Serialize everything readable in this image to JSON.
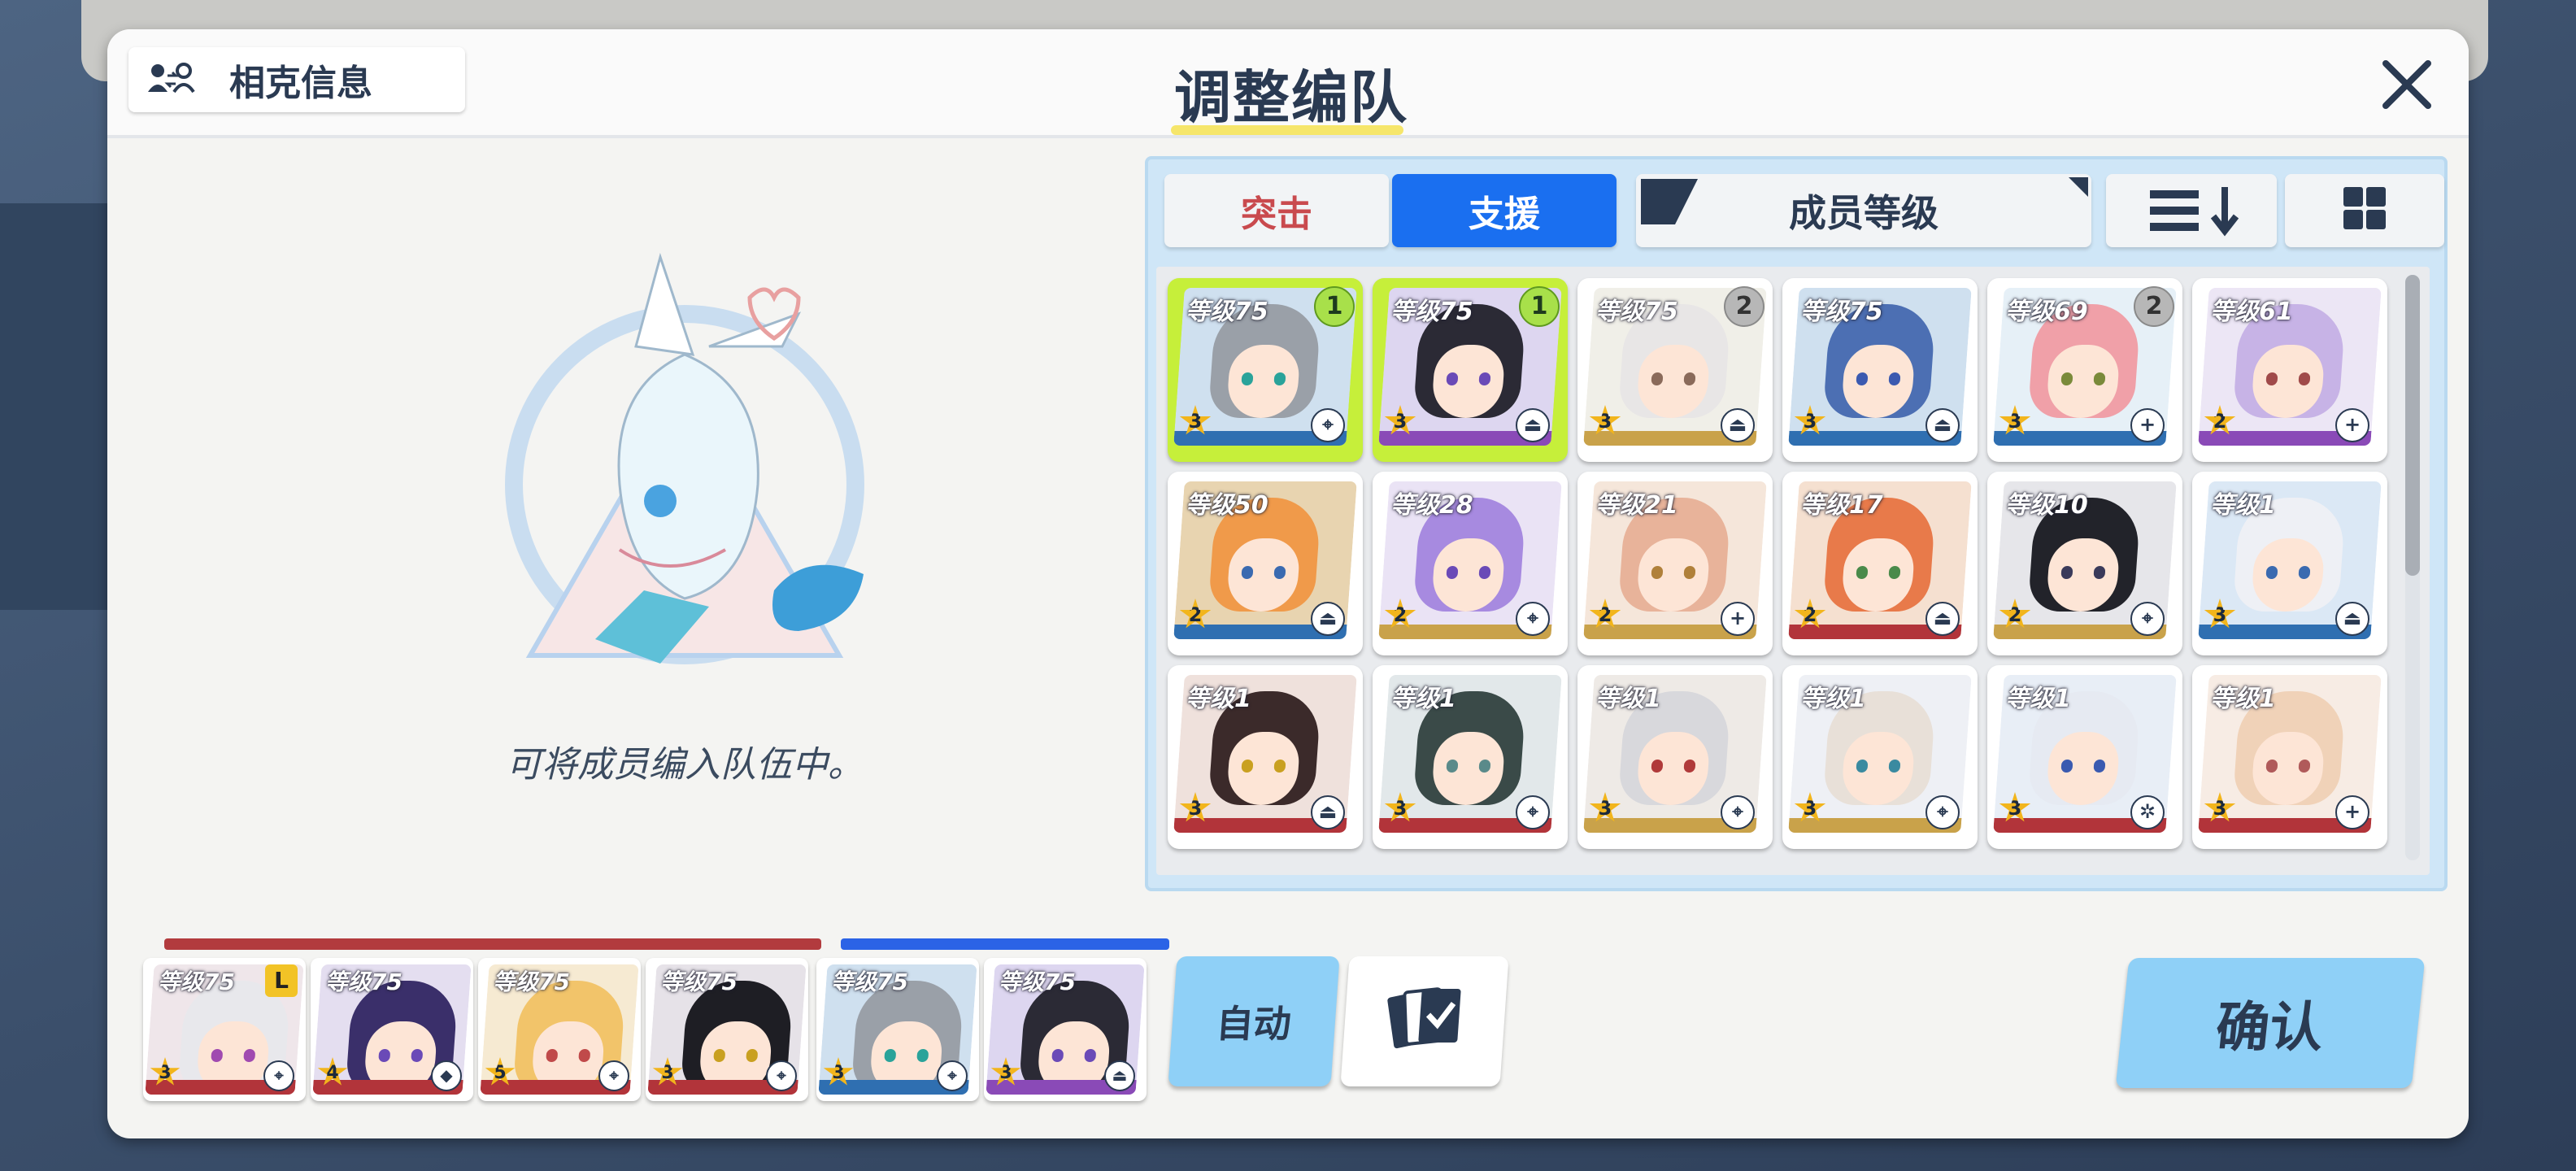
{
  "header": {
    "counter_label": "相克信息",
    "title": "调整编队"
  },
  "empty_state": {
    "hint": "可将成员编入队伍中。"
  },
  "panel": {
    "tabs": [
      {
        "label": "突击",
        "active": false
      },
      {
        "label": "支援",
        "active": true
      }
    ],
    "filter_label": "成员等级",
    "roster": [
      {
        "level": "等级75",
        "star": "3",
        "role": "attack",
        "badge": "1",
        "badge_color": "green",
        "selected": true,
        "hair": "#9aa0a8",
        "bg": "#cfe0ef",
        "strip": "#2f6fb1",
        "eye": "#2aa39a"
      },
      {
        "level": "等级75",
        "star": "3",
        "role": "support",
        "badge": "1",
        "badge_color": "green",
        "selected": true,
        "hair": "#2b2a35",
        "bg": "#ddd6f0",
        "strip": "#8a4ab7",
        "eye": "#6a4ab7"
      },
      {
        "level": "等级75",
        "star": "3",
        "role": "support",
        "badge": "2",
        "badge_color": "gray",
        "selected": false,
        "hair": "#e8e6e6",
        "bg": "#f0efe8",
        "strip": "#c9a24a",
        "eye": "#8a6a5a"
      },
      {
        "level": "等级75",
        "star": "3",
        "role": "support",
        "badge": "",
        "badge_color": "",
        "selected": false,
        "hair": "#4c6fb3",
        "bg": "#cfe0ef",
        "strip": "#2f6fb1",
        "eye": "#3b5ab0"
      },
      {
        "level": "等级69",
        "star": "3",
        "role": "heal",
        "badge": "2",
        "badge_color": "gray",
        "selected": false,
        "hair": "#f0a0a8",
        "bg": "#e6f0f7",
        "strip": "#2f6fb1",
        "eye": "#7a8a3a"
      },
      {
        "level": "等级61",
        "star": "2",
        "role": "heal",
        "badge": "",
        "badge_color": "",
        "selected": false,
        "hair": "#c7b3e6",
        "bg": "#ece6f5",
        "strip": "#8a4ab7",
        "eye": "#a04a4a"
      },
      {
        "level": "等级50",
        "star": "2",
        "role": "support",
        "badge": "",
        "badge_color": "",
        "selected": false,
        "hair": "#f09a4a",
        "bg": "#e8d4b0",
        "strip": "#2f6fb1",
        "eye": "#3a6ab0"
      },
      {
        "level": "等级28",
        "star": "2",
        "role": "attack",
        "badge": "",
        "badge_color": "",
        "selected": false,
        "hair": "#a78ae0",
        "bg": "#eae3f5",
        "strip": "#c9a24a",
        "eye": "#6a4ab7"
      },
      {
        "level": "等级21",
        "star": "2",
        "role": "heal",
        "badge": "",
        "badge_color": "",
        "selected": false,
        "hair": "#e8b39a",
        "bg": "#f5e6da",
        "strip": "#c9a24a",
        "eye": "#b0803a"
      },
      {
        "level": "等级17",
        "star": "2",
        "role": "support",
        "badge": "",
        "badge_color": "",
        "selected": false,
        "hair": "#e87a4a",
        "bg": "#f5e0d0",
        "strip": "#b2343a",
        "eye": "#4a8a4a"
      },
      {
        "level": "等级10",
        "star": "2",
        "role": "attack",
        "badge": "",
        "badge_color": "",
        "selected": false,
        "hair": "#22232a",
        "bg": "#e6e6ea",
        "strip": "#c9a24a",
        "eye": "#3a3a5a"
      },
      {
        "level": "等级1",
        "star": "3",
        "role": "support",
        "badge": "",
        "badge_color": "",
        "selected": false,
        "hair": "#eef0f5",
        "bg": "#dbe8f5",
        "strip": "#2f6fb1",
        "eye": "#3a6ab0"
      },
      {
        "level": "等级1",
        "star": "3",
        "role": "support",
        "badge": "",
        "badge_color": "",
        "selected": false,
        "hair": "#3b2a2a",
        "bg": "#efe1dc",
        "strip": "#b2343a",
        "eye": "#c9a020"
      },
      {
        "level": "等级1",
        "star": "3",
        "role": "attack",
        "badge": "",
        "badge_color": "",
        "selected": false,
        "hair": "#3a4a48",
        "bg": "#e2e8ea",
        "strip": "#b2343a",
        "eye": "#5a8a8a"
      },
      {
        "level": "等级1",
        "star": "3",
        "role": "attack",
        "badge": "",
        "badge_color": "",
        "selected": false,
        "hair": "#d8d8dc",
        "bg": "#eeeae6",
        "strip": "#c9a24a",
        "eye": "#b03a3a"
      },
      {
        "level": "等级1",
        "star": "3",
        "role": "attack",
        "badge": "",
        "badge_color": "",
        "selected": false,
        "hair": "#e8e0d8",
        "bg": "#eef0f5",
        "strip": "#c9a24a",
        "eye": "#3a8aa0"
      },
      {
        "level": "等级1",
        "star": "3",
        "role": "tactic",
        "badge": "",
        "badge_color": "",
        "selected": false,
        "hair": "#e6eaf2",
        "bg": "#e8eef6",
        "strip": "#b2343a",
        "eye": "#3a5ab0"
      },
      {
        "level": "等级1",
        "star": "3",
        "role": "heal",
        "badge": "",
        "badge_color": "",
        "selected": false,
        "hair": "#f0d2b8",
        "bg": "#f7ece4",
        "strip": "#b2343a",
        "eye": "#b05a5a"
      }
    ]
  },
  "formation": {
    "strikers": [
      {
        "level": "等级75",
        "star": "3",
        "role": "attack",
        "leader": "L",
        "hair": "#e8e8ec",
        "bg": "#efe6ea",
        "strip": "#b2343a",
        "eye": "#a04ab0"
      },
      {
        "level": "等级75",
        "star": "4",
        "role": "tank",
        "leader": "",
        "hair": "#3a2f6a",
        "bg": "#e4def0",
        "strip": "#b2343a",
        "eye": "#6a4ab7"
      },
      {
        "level": "等级75",
        "star": "5",
        "role": "attack",
        "leader": "",
        "hair": "#f2c46a",
        "bg": "#f6ead2",
        "strip": "#b2343a",
        "eye": "#c04a4a"
      },
      {
        "level": "等级75",
        "star": "3",
        "role": "attack",
        "leader": "",
        "hair": "#1e1e24",
        "bg": "#e6e2e8",
        "strip": "#b2343a",
        "eye": "#c9a020"
      }
    ],
    "specials": [
      {
        "level": "等级75",
        "star": "3",
        "role": "attack",
        "hair": "#9aa0a8",
        "bg": "#cfe0ef",
        "strip": "#2f6fb1",
        "eye": "#2aa39a"
      },
      {
        "level": "等级75",
        "star": "3",
        "role": "support",
        "hair": "#2b2a35",
        "bg": "#ddd6f0",
        "strip": "#8a4ab7",
        "eye": "#6a4ab7"
      }
    ],
    "auto_label": "自动",
    "confirm_label": "确认"
  },
  "colors": {
    "accent_blue": "#1a6ff0",
    "striker_red": "#b23b3e",
    "special_blue": "#2b63e6",
    "selected_green": "#c6ef3a",
    "title_underline": "#f6e66b"
  }
}
